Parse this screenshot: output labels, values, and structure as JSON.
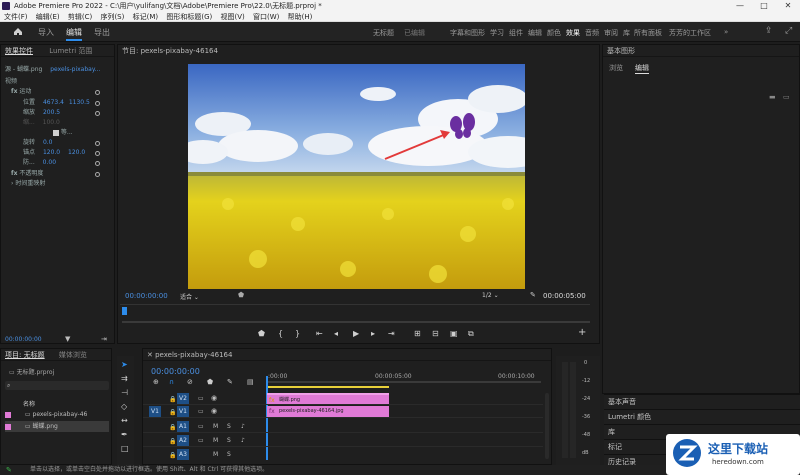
{
  "window": {
    "title": "Adobe Premiere Pro 2022 - C:\\用户\\yulifang\\文档\\Adobe\\Premiere Pro\\22.0\\无标题.prproj *",
    "minimize": "—",
    "maximize": "□",
    "close": "✕"
  },
  "menu": [
    "文件(F)",
    "编辑(E)",
    "剪辑(C)",
    "序列(S)",
    "标记(M)",
    "图形和标题(G)",
    "视图(V)",
    "窗口(W)",
    "帮助(H)"
  ],
  "header": {
    "nav": [
      "导入",
      "编辑",
      "导出"
    ],
    "active_nav": "编辑",
    "project_name": "无标题",
    "save_status": "已编辑",
    "workspaces": [
      "字幕和图形",
      "学习",
      "组件",
      "编辑",
      "颜色",
      "效果",
      "音频",
      "审阅",
      "库",
      "所有面板",
      "芳芳的工作区"
    ],
    "active_workspace": "效果"
  },
  "effect_controls": {
    "tabs": [
      "效果控件",
      "Lumetri 范围"
    ],
    "source_label": "源 - 蝴蝶.png",
    "sequence_label": "pexels-pixabay...",
    "section_video": "视频",
    "motion": "运动",
    "position_label": "位置",
    "position_x": "4673.4",
    "position_y": "1130.5",
    "scale_label": "缩放",
    "scale_value": "200.5",
    "scale_width_label": "缩...",
    "scale_width_value": "100.0",
    "uniform_label": "等...",
    "rotation_label": "旋转",
    "rotation_value": "0.0",
    "anchor_label": "锚点",
    "anchor_x": "120.0",
    "anchor_y": "120.0",
    "antiflicker_label": "防...",
    "antiflicker_value": "0.00",
    "opacity_label": "不透明度",
    "time_remap_label": "时间重映射",
    "timecode": "00:00:00:00"
  },
  "program_monitor": {
    "tab": "节目: pexels-pixabay-46164",
    "timecode_in": "00:00:00:00",
    "fit": "适合",
    "resolution": "1/2",
    "timecode_out": "00:00:05:00"
  },
  "essential_graphics": {
    "title": "基本图形",
    "tabs": [
      "浏览",
      "编辑"
    ],
    "active_tab": "编辑"
  },
  "right_bottom_panels": [
    "基本声音",
    "Lumetri 颜色",
    "库",
    "标记",
    "历史记录"
  ],
  "project": {
    "tabs": [
      "项目: 无标题",
      "媒体浏览"
    ],
    "file": "无标题.prproj",
    "name_header": "名称",
    "items": [
      "pexels-pixabay-46",
      "蝴蝶.png"
    ]
  },
  "timeline": {
    "tab": "pexels-pixabay-46164",
    "timecode": "00:00:00:00",
    "ruler": [
      ":00:00",
      "00:00:05:00",
      "00:00:10:00"
    ],
    "tracks": [
      "V2",
      "V1",
      "A1",
      "A2",
      "A3"
    ],
    "clip_overlay": "蝴蝶.png",
    "clip_base": "pexels-pixabay-46164.jpg",
    "meter_labels": [
      "0",
      "-12",
      "-24",
      "-36",
      "-48",
      "dB"
    ]
  },
  "status": "单击以选择，或单击空白处并拖动以进行框选。使用 Shift、Alt 和 Ctrl 可获得其他选项。",
  "watermark": {
    "line1": "这里下载站",
    "line2": "heredown.com"
  },
  "colors": {
    "accent": "#2d8ceb",
    "clip_pink": "#e07ad6",
    "label_blue": "#1e4f86"
  }
}
